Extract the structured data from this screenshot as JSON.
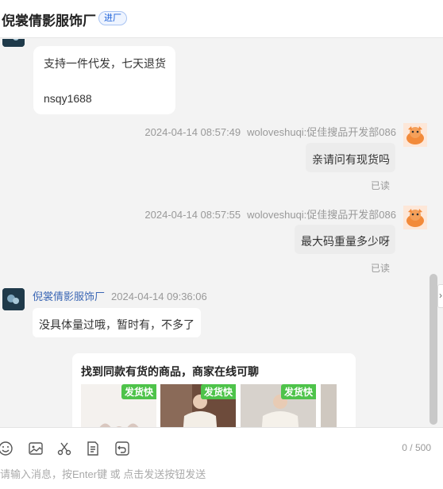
{
  "header": {
    "shop_name": "倪裳倩影服饰厂",
    "enter_tag": "进厂"
  },
  "messages": {
    "shop_msg_1": {
      "line1": "支持一件代发，七天退货",
      "line2": "nsqy1688"
    },
    "user_msg_1": {
      "time": "2024-04-14 08:57:49",
      "sender": "woloveshuqi:促佳搜品开发部086",
      "text": "亲请问有现货吗",
      "status": "已读"
    },
    "user_msg_2": {
      "time": "2024-04-14 08:57:55",
      "sender": "woloveshuqi:促佳搜品开发部086",
      "text": "最大码重量多少呀",
      "status": "已读"
    },
    "shop_msg_2": {
      "sender": "倪裳倩影服饰厂",
      "time": "2024-04-14 09:36:06",
      "text": "没具体量过哦，暂时有，不多了"
    },
    "product_card": {
      "title": "找到同款有货的商品，商家在线可聊",
      "tag": "发货快",
      "items": [
        {
          "tag": "发货快"
        },
        {
          "tag": "发货快"
        },
        {
          "tag": "发货快"
        }
      ]
    }
  },
  "toolbar": {
    "icons": [
      "emoji-icon",
      "image-icon",
      "scissors-icon",
      "order-icon",
      "undo-icon"
    ],
    "counter": "0 / 500",
    "input_placeholder": "请输入消息，按Enter键 或 点击发送按钮发送"
  },
  "colors": {
    "shop_name_link": "#3a66b4",
    "tag_green": "#4ec34a",
    "enter_tag_blue": "#1a5fd8"
  }
}
